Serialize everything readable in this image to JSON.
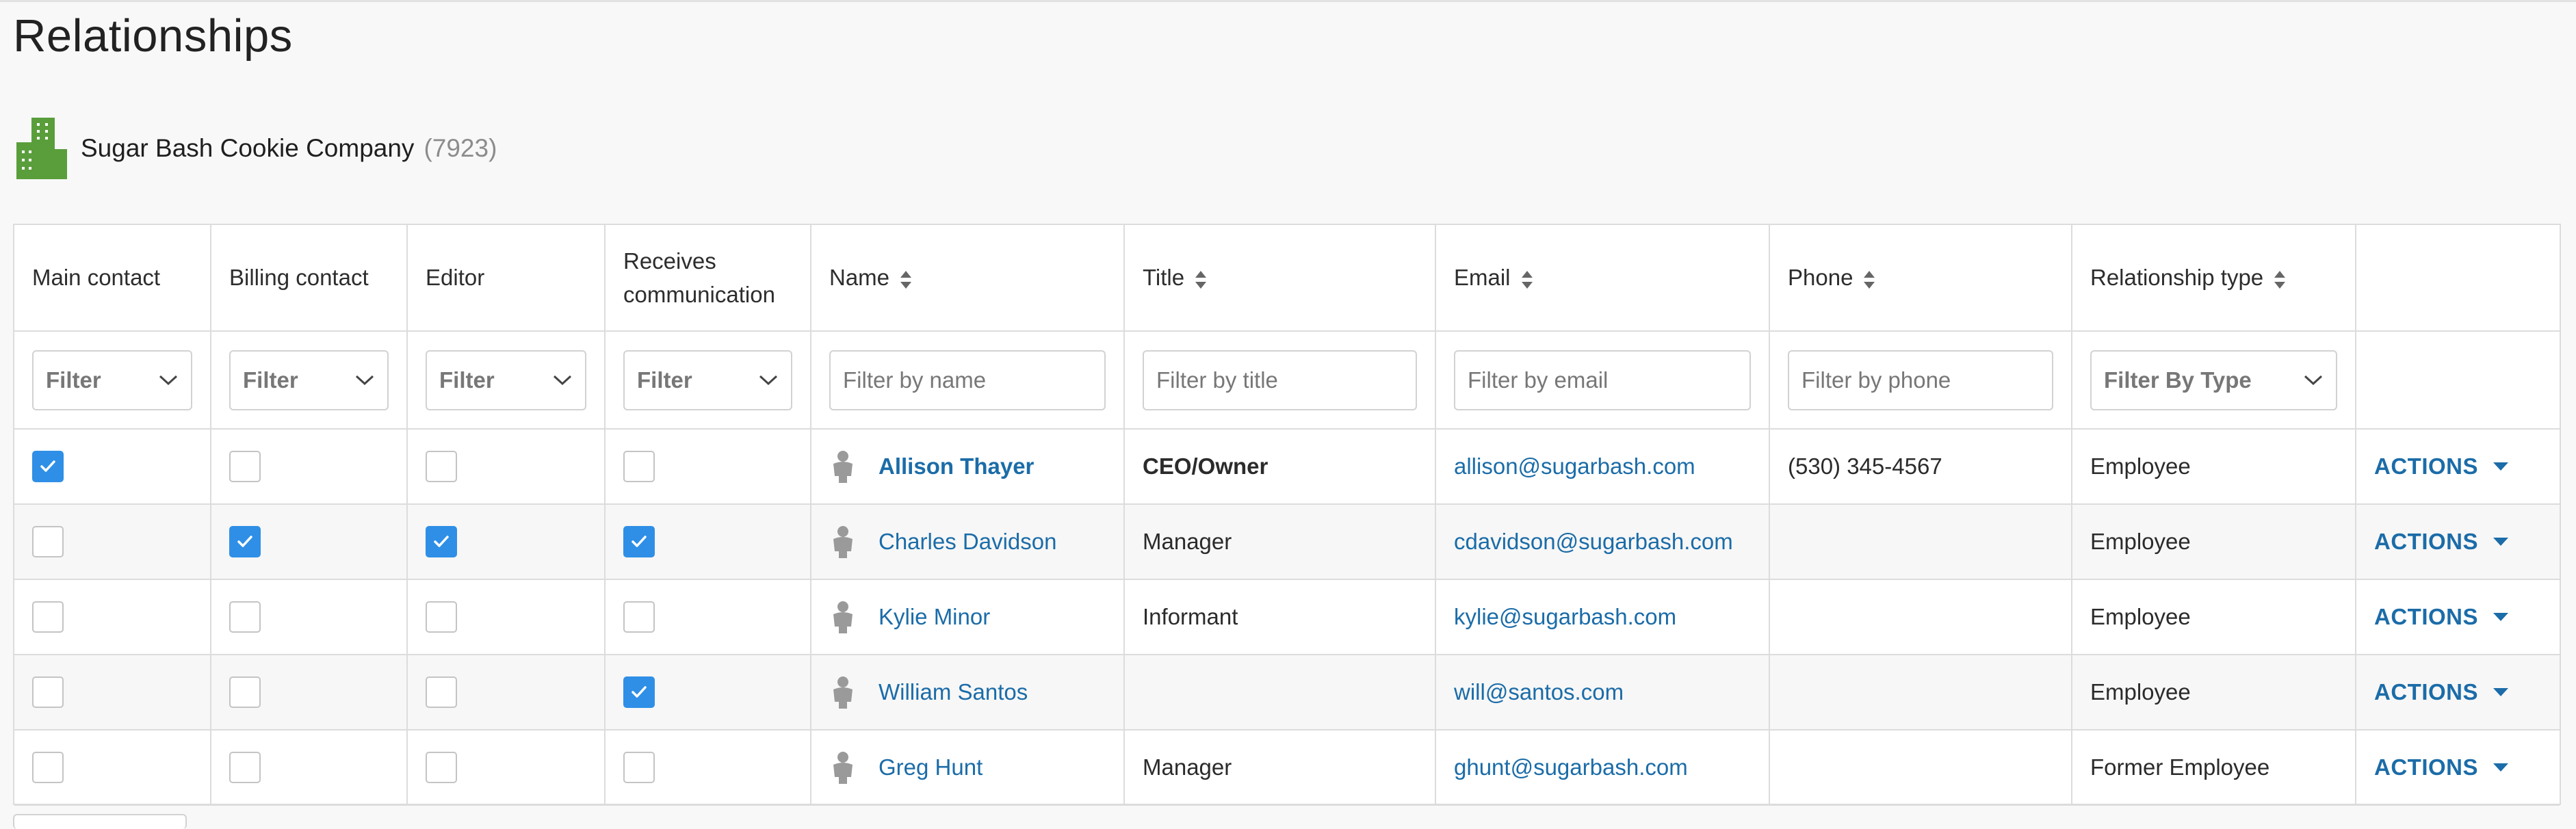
{
  "page": {
    "title": "Relationships"
  },
  "company": {
    "name": "Sugar Bash Cookie Company",
    "id": "(7923)",
    "icon": "building-icon",
    "icon_color": "#5a9e3c"
  },
  "columns": {
    "main_contact": "Main contact",
    "billing_contact": "Billing contact",
    "editor": "Editor",
    "receives_communication": "Receives communication",
    "name": "Name",
    "title": "Title",
    "email": "Email",
    "phone": "Phone",
    "relationship_type": "Relationship type"
  },
  "filters": {
    "main_contact": "Filter",
    "billing_contact": "Filter",
    "editor": "Filter",
    "receives_communication": "Filter",
    "name_placeholder": "Filter by name",
    "title_placeholder": "Filter by title",
    "email_placeholder": "Filter by email",
    "phone_placeholder": "Filter by phone",
    "type": "Filter By Type"
  },
  "actions_label": "ACTIONS",
  "accent_color": "#2f8fe6",
  "link_color": "#1b6ca8",
  "rows": [
    {
      "main": true,
      "billing": false,
      "editor": false,
      "receives": false,
      "name": "Allison Thayer",
      "title": "CEO/Owner",
      "email": "allison@sugarbash.com",
      "phone": "(530) 345-4567",
      "type": "Employee"
    },
    {
      "main": false,
      "billing": true,
      "editor": true,
      "receives": true,
      "name": "Charles Davidson",
      "title": "Manager",
      "email": "cdavidson@sugarbash.com",
      "phone": "",
      "type": "Employee"
    },
    {
      "main": false,
      "billing": false,
      "editor": false,
      "receives": false,
      "name": "Kylie Minor",
      "title": "Informant",
      "email": "kylie@sugarbash.com",
      "phone": "",
      "type": "Employee"
    },
    {
      "main": false,
      "billing": false,
      "editor": false,
      "receives": true,
      "name": "William Santos",
      "title": "",
      "email": "will@santos.com",
      "phone": "",
      "type": "Employee"
    },
    {
      "main": false,
      "billing": false,
      "editor": false,
      "receives": false,
      "name": "Greg Hunt",
      "title": "Manager",
      "email": "ghunt@sugarbash.com",
      "phone": "",
      "type": "Former Employee"
    }
  ]
}
